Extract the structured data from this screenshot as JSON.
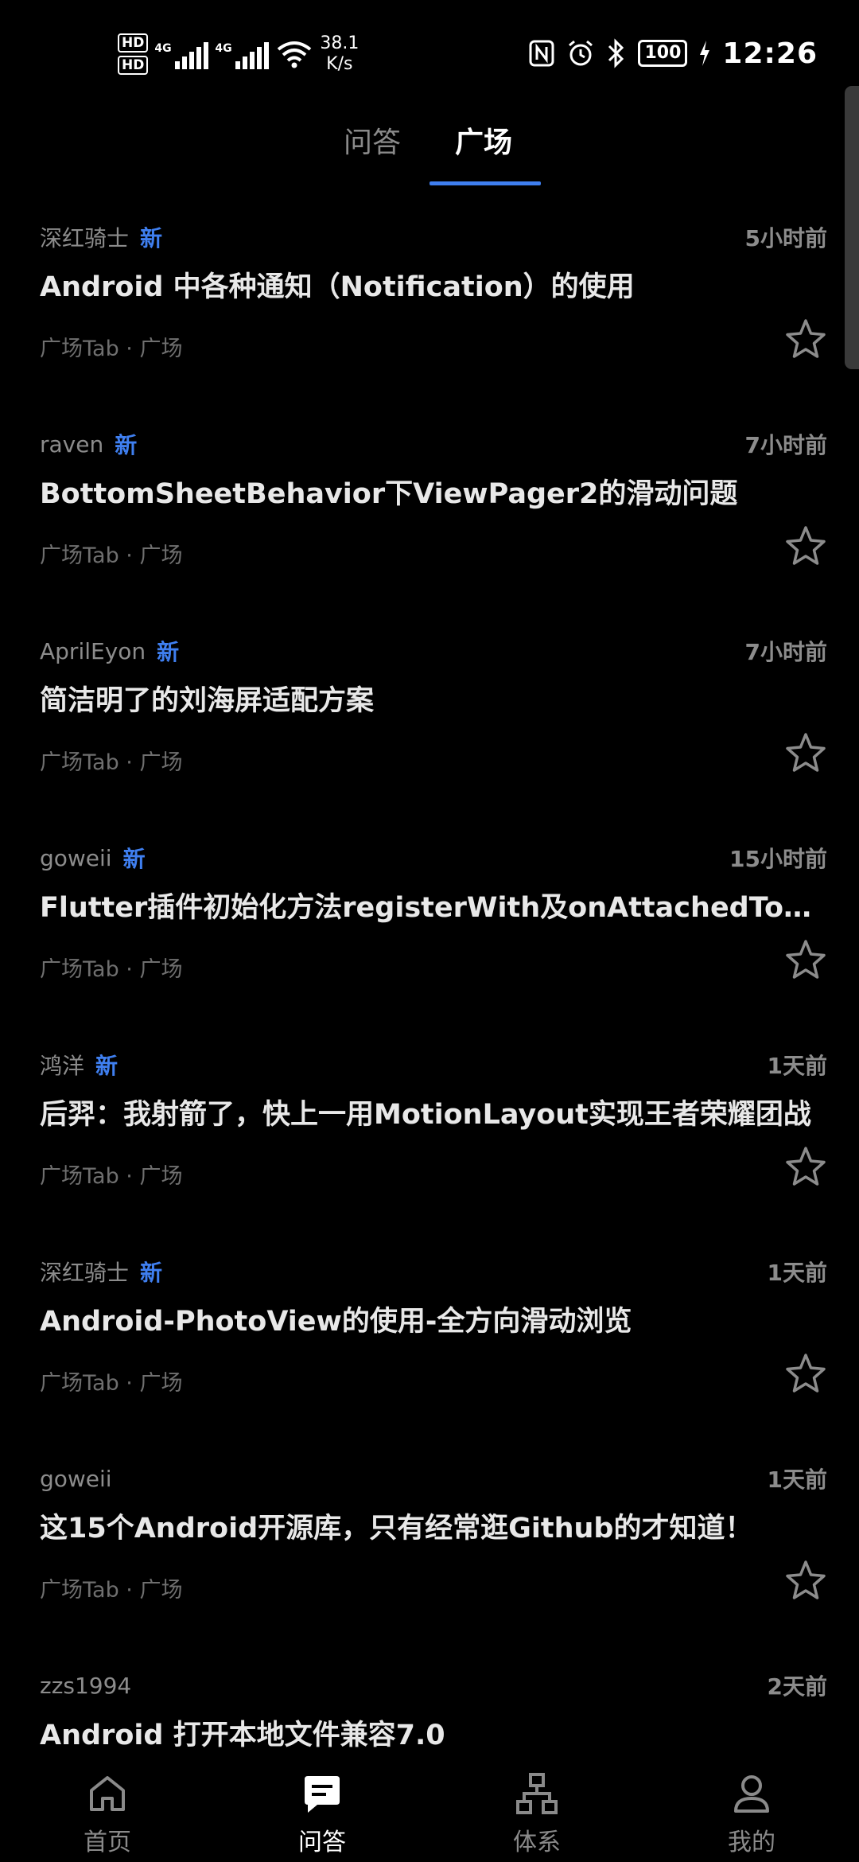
{
  "status_bar": {
    "hd1": "HD",
    "hd2": "HD",
    "net1": "4G",
    "net2": "4G",
    "speed_value": "38.1",
    "speed_unit": "K/s",
    "battery": "100",
    "time": "12:26"
  },
  "tabs": [
    {
      "label": "问答",
      "active": false
    },
    {
      "label": "广场",
      "active": true
    }
  ],
  "new_badge": "新",
  "feed": [
    {
      "author": "深红骑士",
      "is_new": true,
      "time": "5小时前",
      "title": "Android 中各种通知（Notification）的使用",
      "tags": "广场Tab · 广场"
    },
    {
      "author": "raven",
      "is_new": true,
      "time": "7小时前",
      "title": "BottomSheetBehavior下ViewPager2的滑动问题",
      "tags": "广场Tab · 广场"
    },
    {
      "author": "AprilEyon",
      "is_new": true,
      "time": "7小时前",
      "title": "简洁明了的刘海屏适配方案",
      "tags": "广场Tab · 广场"
    },
    {
      "author": "goweii",
      "is_new": true,
      "time": "15小时前",
      "title": "Flutter插件初始化方法registerWith及onAttachedToEngin…",
      "tags": "广场Tab · 广场"
    },
    {
      "author": "鸿洋",
      "is_new": true,
      "time": "1天前",
      "title": "后羿：我射箭了，快上一用MotionLayout实现王者荣耀团战",
      "tags": "广场Tab · 广场"
    },
    {
      "author": "深红骑士",
      "is_new": true,
      "time": "1天前",
      "title": "Android-PhotoView的使用-全方向滑动浏览",
      "tags": "广场Tab · 广场"
    },
    {
      "author": "goweii",
      "is_new": false,
      "time": "1天前",
      "title": "这15个Android开源库，只有经常逛Github的才知道！",
      "tags": "广场Tab · 广场"
    },
    {
      "author": "zzs1994",
      "is_new": false,
      "time": "2天前",
      "title": "Android 打开本地文件兼容7.0",
      "tags": ""
    }
  ],
  "bottom_nav": [
    {
      "label": "首页",
      "icon": "home-icon",
      "active": false
    },
    {
      "label": "问答",
      "icon": "chat-icon",
      "active": true
    },
    {
      "label": "体系",
      "icon": "hierarchy-icon",
      "active": false
    },
    {
      "label": "我的",
      "icon": "person-icon",
      "active": false
    }
  ],
  "colors": {
    "background": "#000000",
    "accent": "#3f7ff0",
    "muted": "#8c8c8c"
  }
}
